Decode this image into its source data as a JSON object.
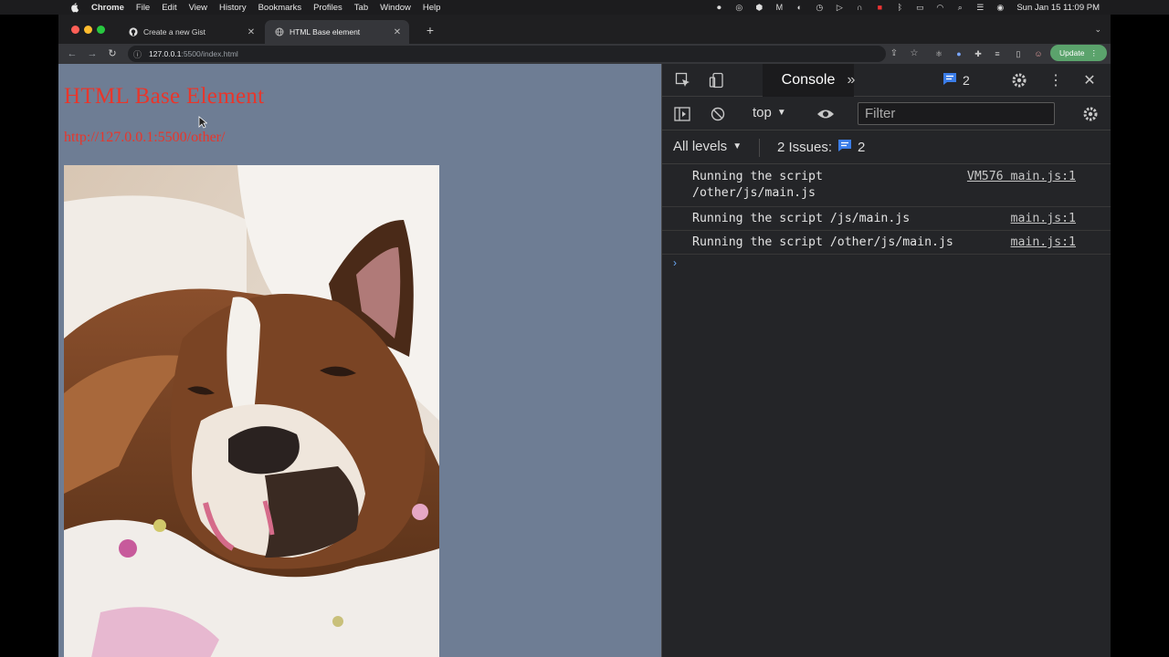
{
  "menubar": {
    "app": "Chrome",
    "items": [
      "File",
      "Edit",
      "View",
      "History",
      "Bookmarks",
      "Profiles",
      "Tab",
      "Window",
      "Help"
    ],
    "clock": "Sun Jan 15  11:09 PM"
  },
  "tabs": [
    {
      "title": "Create a new Gist",
      "icon": "github-icon"
    },
    {
      "title": "HTML Base element",
      "icon": "globe-icon"
    }
  ],
  "toolbar": {
    "url_host": "127.0.0.1",
    "url_path": ":5500/index.html",
    "update_label": "Update"
  },
  "page": {
    "heading": "HTML Base Element",
    "link": "http://127.0.0.1:5500/other/",
    "background": "#6e7d94",
    "accent": "#e8362b"
  },
  "devtools": {
    "active_tab": "Console",
    "issue_count": "2",
    "context": "top",
    "filter_placeholder": "Filter",
    "levels_label": "All levels",
    "issues_label": "2 Issues:",
    "issues_count": "2",
    "logs": [
      {
        "message": "Running the script\n/other/js/main.js",
        "source": "VM576 main.js:1"
      },
      {
        "message": "Running the script /js/main.js",
        "source": "main.js:1"
      },
      {
        "message": "Running the script /other/js/main.js",
        "source": "main.js:1"
      }
    ]
  }
}
